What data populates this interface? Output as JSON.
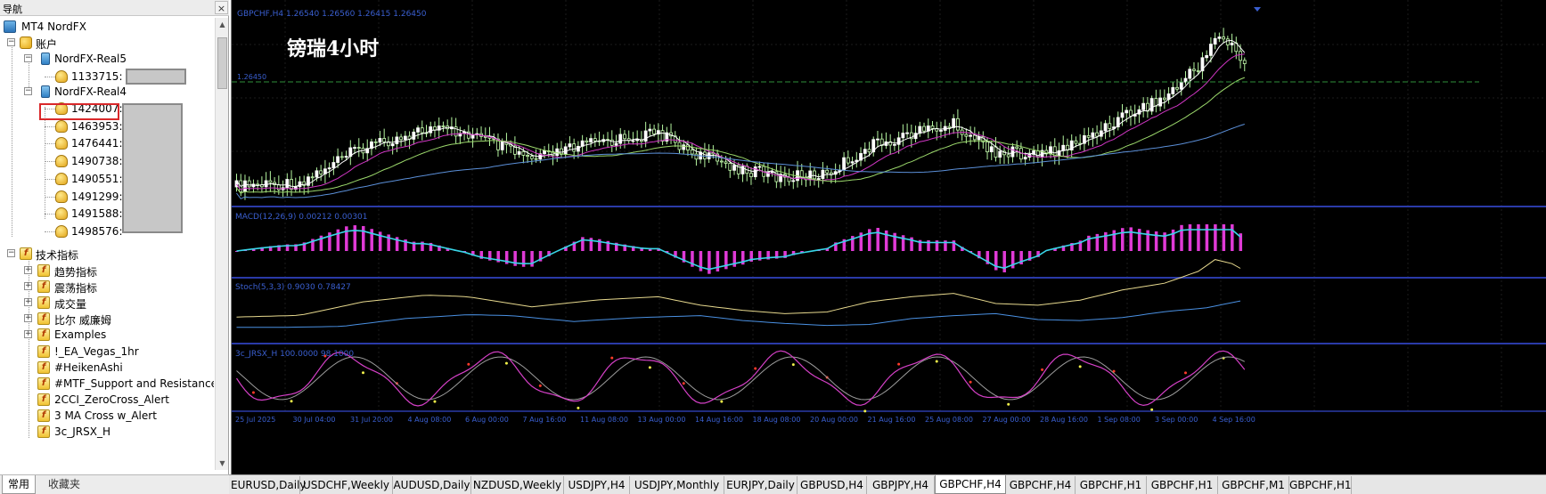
{
  "navigator": {
    "title": "导航",
    "close_glyph": "×",
    "tree": {
      "root_label": "MT4 NordFX",
      "accounts_label": "账户",
      "servers": [
        {
          "name": "NordFX-Real5",
          "accounts": [
            "1133715:"
          ]
        },
        {
          "name": "NordFX-Real4",
          "accounts": [
            "1424007:",
            "1463953:",
            "1476441:",
            "1490738:",
            "1490551:",
            "1491299:",
            "1491588:",
            "1498576:"
          ]
        }
      ],
      "indicators_label": "技术指标",
      "indicator_groups": [
        "趋势指标",
        "震荡指标",
        "成交量",
        "比尔 威廉姆",
        "Examples"
      ],
      "custom_indicators": [
        "!_EA_Vegas_1hr",
        "#HeikenAshi",
        "#MTF_Support and Resistance",
        "2CCI_ZeroCross_Alert",
        "3 MA Cross w_Alert",
        "3c_JRSX_H"
      ]
    },
    "tabs": [
      "常用",
      "收藏夹"
    ]
  },
  "chart": {
    "annotation": "镑瑞4小时",
    "main_legend": "GBPCHF,H4 1.26540 1.26560 1.26415 1.26450",
    "price_label": "1.26450",
    "macd_legend": "MACD(12,26,9) 0.00212 0.00301",
    "stoch_legend": "Stoch(5,3,3) 0.9030 0.78427",
    "osc_legend": "3c_JRSX_H 100.0000 98.1000",
    "time_labels": [
      "25 Jul 2025",
      "30 Jul 04:00",
      "31 Jul 20:00",
      "4 Aug 08:00",
      "6 Aug 00:00",
      "7 Aug 16:00",
      "11 Aug 08:00",
      "13 Aug 00:00",
      "14 Aug 16:00",
      "18 Aug 08:00",
      "20 Aug 00:00",
      "21 Aug 16:00",
      "25 Aug 08:00",
      "27 Aug 00:00",
      "28 Aug 16:00",
      "1 Sep 08:00",
      "3 Sep 00:00",
      "4 Sep 16:00"
    ],
    "colors": {
      "bull": "#ffffff",
      "bear": "#c8ffb0",
      "wick": "#b4f5a0",
      "ma_fast": "#ffffff",
      "ma_mid": "#d036c4",
      "ma_slow": "#9bd86b",
      "ma_long": "#5b8fd8",
      "bid_line": "#2f8f3a",
      "macd_hist": "#e03ad6",
      "macd_signal": "#38d6e8",
      "stoch_main": "#e7d98e",
      "stoch_signal": "#4a90e2",
      "osc_main": "#d640c8",
      "osc_signal": "#9d9d9d"
    }
  },
  "chart_tabs": [
    {
      "label": "EURUSD,Daily",
      "active": false
    },
    {
      "label": "USDCHF,Weekly",
      "active": false
    },
    {
      "label": "AUDUSD,Daily",
      "active": false
    },
    {
      "label": "NZDUSD,Weekly",
      "active": false
    },
    {
      "label": "USDJPY,H4",
      "active": false
    },
    {
      "label": "USDJPY,Monthly",
      "active": false
    },
    {
      "label": "EURJPY,Daily",
      "active": false
    },
    {
      "label": "GBPUSD,H4",
      "active": false
    },
    {
      "label": "GBPJPY,H4",
      "active": false
    },
    {
      "label": "GBPCHF,H4",
      "active": true
    },
    {
      "label": "GBPCHF,H4",
      "active": false
    },
    {
      "label": "GBPCHF,H1",
      "active": false
    },
    {
      "label": "GBPCHF,H1",
      "active": false
    },
    {
      "label": "GBPCHF,M1",
      "active": false
    },
    {
      "label": "GBPCHF,H1",
      "active": false
    }
  ]
}
